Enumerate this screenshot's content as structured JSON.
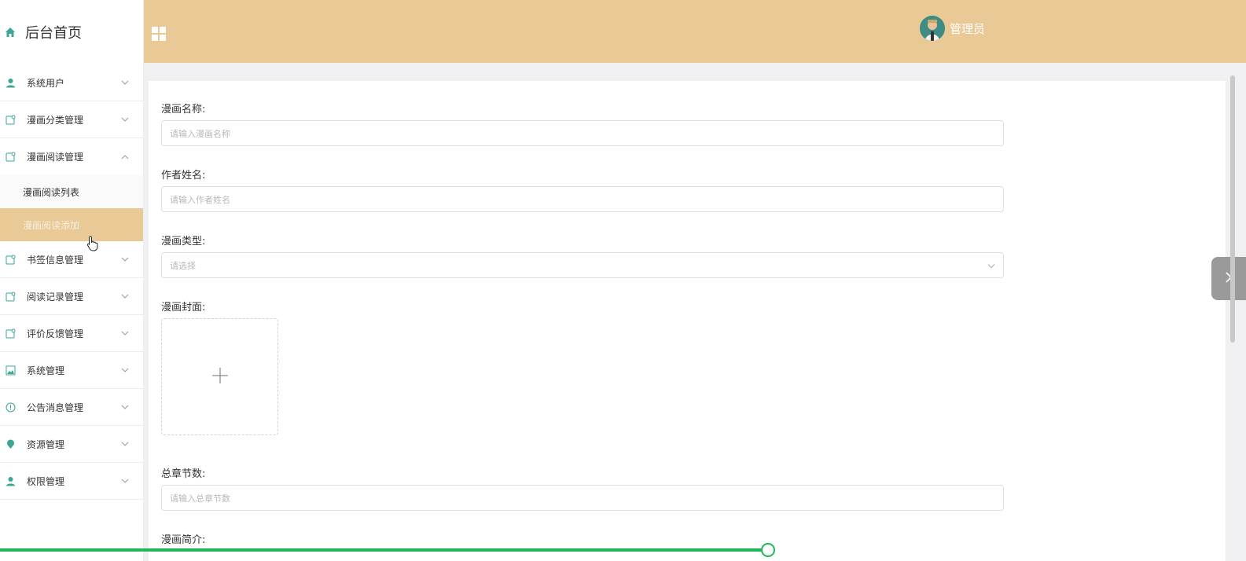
{
  "sidebar": {
    "brand": "后台首页",
    "items": [
      {
        "label": "系统用户",
        "icon": "user-icon"
      },
      {
        "label": "漫画分类管理",
        "icon": "note-icon"
      },
      {
        "label": "漫画阅读管理",
        "icon": "note-icon",
        "open": true,
        "children": [
          {
            "label": "漫画阅读列表"
          },
          {
            "label": "漫画阅读添加",
            "active": true
          }
        ]
      },
      {
        "label": "书签信息管理",
        "icon": "note-icon"
      },
      {
        "label": "阅读记录管理",
        "icon": "note-icon"
      },
      {
        "label": "评价反馈管理",
        "icon": "note-icon"
      },
      {
        "label": "系统管理",
        "icon": "image-icon"
      },
      {
        "label": "公告消息管理",
        "icon": "info-icon"
      },
      {
        "label": "资源管理",
        "icon": "location-icon"
      },
      {
        "label": "权限管理",
        "icon": "user-icon"
      }
    ]
  },
  "header": {
    "user_name": "管理员"
  },
  "form": {
    "name_label": "漫画名称:",
    "name_placeholder": "请输入漫画名称",
    "author_label": "作者姓名:",
    "author_placeholder": "请输入作者姓名",
    "type_label": "漫画类型:",
    "type_placeholder": "请选择",
    "cover_label": "漫画封面:",
    "chapters_label": "总章节数:",
    "chapters_placeholder": "请输入总章节数",
    "intro_label": "漫画简介:"
  },
  "colors": {
    "accent": "#e9c995",
    "icon": "#3aa693",
    "progress": "#1db954"
  }
}
